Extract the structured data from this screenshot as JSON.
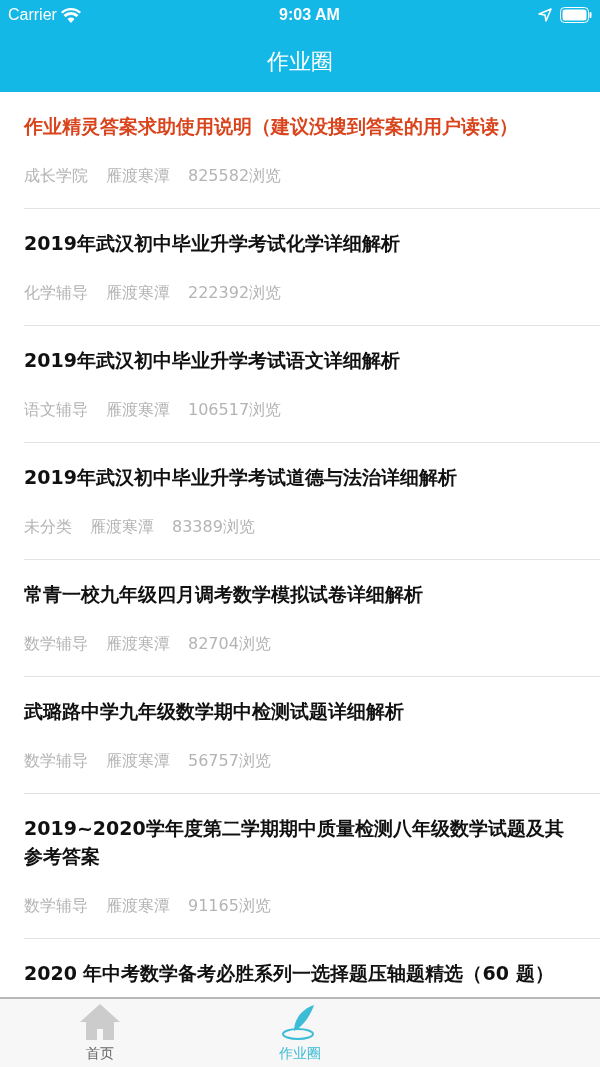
{
  "status_bar": {
    "carrier": "Carrier",
    "time": "9:03 AM"
  },
  "nav": {
    "title": "作业圈"
  },
  "posts": [
    {
      "title": "作业精灵答案求助使用说明（建议没搜到答案的用户读读）",
      "highlighted": true,
      "category": "成长学院",
      "author": "雁渡寒潭",
      "views": "825582浏览"
    },
    {
      "title": "2019年武汉初中毕业升学考试化学详细解析",
      "highlighted": false,
      "category": "化学辅导",
      "author": "雁渡寒潭",
      "views": "222392浏览"
    },
    {
      "title": "2019年武汉初中毕业升学考试语文详细解析",
      "highlighted": false,
      "category": "语文辅导",
      "author": "雁渡寒潭",
      "views": "106517浏览"
    },
    {
      "title": "2019年武汉初中毕业升学考试道德与法治详细解析",
      "highlighted": false,
      "category": "未分类",
      "author": "雁渡寒潭",
      "views": "83389浏览"
    },
    {
      "title": "常青一校九年级四月调考数学模拟试卷详细解析",
      "highlighted": false,
      "category": "数学辅导",
      "author": "雁渡寒潭",
      "views": "82704浏览"
    },
    {
      "title": "武璐路中学九年级数学期中检测试题详细解析",
      "highlighted": false,
      "category": "数学辅导",
      "author": "雁渡寒潭",
      "views": "56757浏览"
    },
    {
      "title": "2019~2020学年度第二学期期中质量检测八年级数学试题及其参考答案",
      "highlighted": false,
      "category": "数学辅导",
      "author": "雁渡寒潭",
      "views": "91165浏览"
    },
    {
      "title": "2020 年中考数学备考必胜系列一选择题压轴题精选（60 题）",
      "highlighted": false
    }
  ],
  "tab_bar": [
    {
      "label": "首页",
      "kind": "home",
      "selected": false
    },
    {
      "label": "作业圈",
      "kind": "feather",
      "selected": true
    }
  ]
}
